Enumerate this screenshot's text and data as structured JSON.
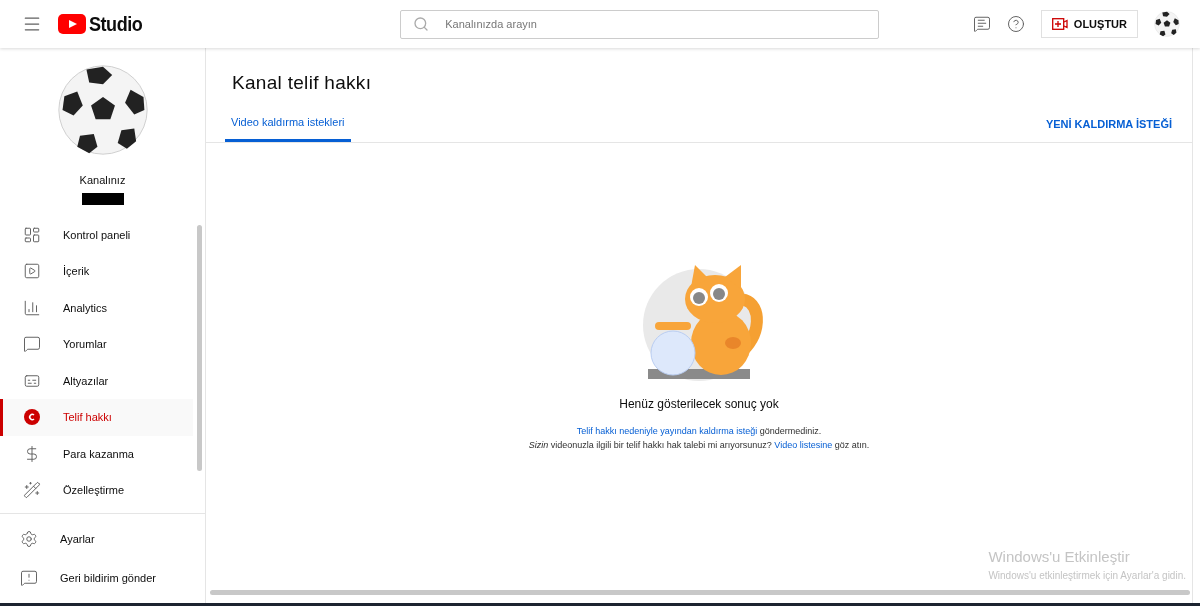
{
  "header": {
    "logo_text": "Studio",
    "search": {
      "placeholder": "Kanalınızda arayın"
    },
    "create_button": "OLUŞTUR"
  },
  "sidebar": {
    "channel_label": "Kanalınız",
    "items": [
      {
        "kind": "dashboard",
        "label": "Kontrol paneli",
        "selected": false
      },
      {
        "kind": "content",
        "label": "İçerik",
        "selected": false
      },
      {
        "kind": "analytics",
        "label": "Analytics",
        "selected": false
      },
      {
        "kind": "comments",
        "label": "Yorumlar",
        "selected": false
      },
      {
        "kind": "subtitles",
        "label": "Altyazılar",
        "selected": false
      },
      {
        "kind": "copyright",
        "label": "Telif hakkı",
        "selected": true
      },
      {
        "kind": "money",
        "label": "Para kazanma",
        "selected": false
      },
      {
        "kind": "customize",
        "label": "Özelleştirme",
        "selected": false
      }
    ],
    "bottom_items": [
      {
        "kind": "settings",
        "label": "Ayarlar"
      },
      {
        "kind": "feedback",
        "label": "Geri bildirim gönder"
      }
    ]
  },
  "main": {
    "title": "Kanal telif hakkı",
    "tabs": [
      {
        "label": "Video kaldırma istekleri",
        "selected": true
      }
    ],
    "action": "YENİ KALDIRMA İSTEĞİ",
    "empty_title": "Henüz gösterilecek sonuç yok",
    "lines": [
      [
        {
          "kind": "link",
          "text": "Telif hakkı nedeniyle yayından kaldırma isteği"
        },
        {
          "kind": "text",
          "text": " göndermediniz."
        }
      ],
      [
        {
          "kind": "text",
          "text": "*Sizin* videonuzla ilgili bir telif hakkı hak talebi mi arıyorsunuz? "
        },
        {
          "kind": "link",
          "text": "Video listesine"
        },
        {
          "kind": "text",
          "text": " göz atın."
        }
      ]
    ]
  },
  "activation": {
    "title": "Windows'u Etkinleştir",
    "subtitle": "Windows'u etkinleştirmek için Ayarlar'a gidin."
  }
}
